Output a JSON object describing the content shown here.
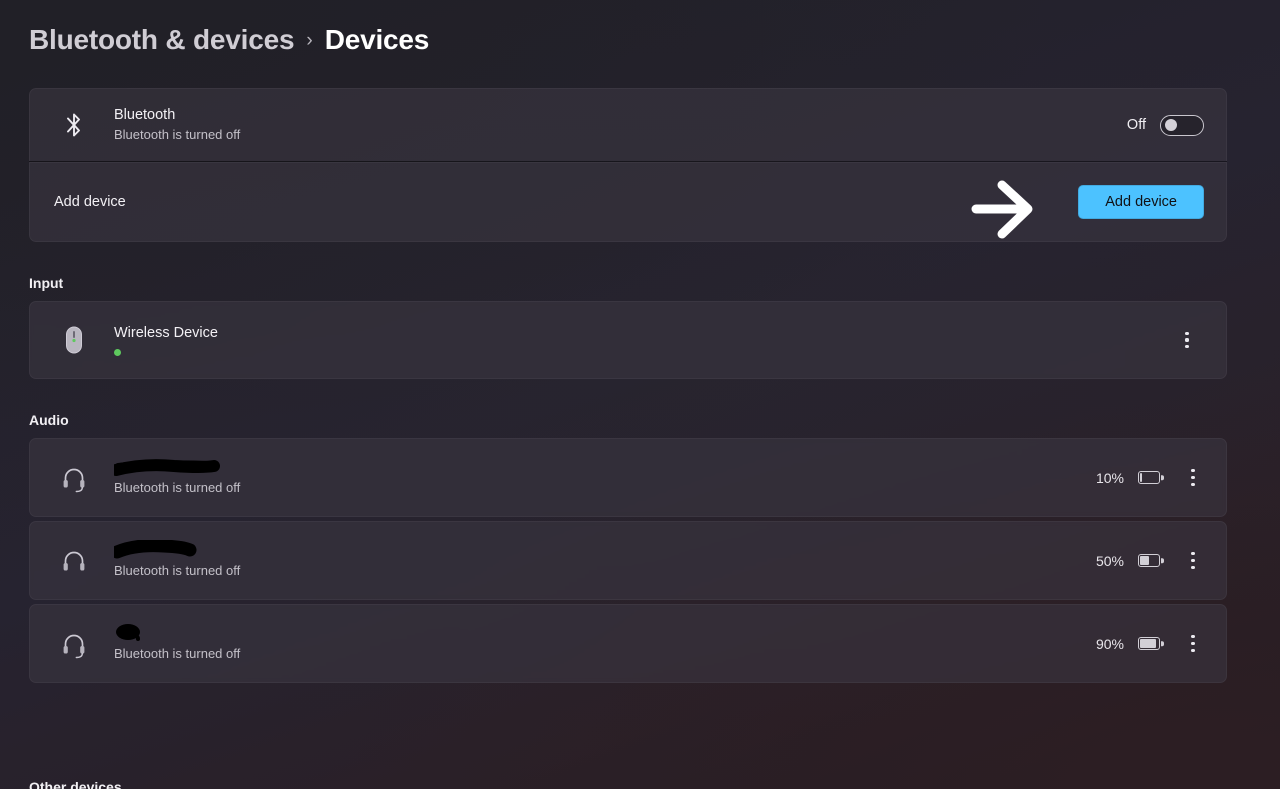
{
  "breadcrumb": {
    "parent": "Bluetooth & devices",
    "separator": "›",
    "current": "Devices"
  },
  "colors": {
    "accent": "#4cc2ff",
    "page_background": "#262330",
    "card_background": "#3a3640",
    "status_connected": "#5ec95e",
    "text_primary": "#ffffff",
    "text_secondary": "#c3c0c8"
  },
  "bluetooth_row": {
    "icon": "bluetooth-icon",
    "title": "Bluetooth",
    "subtitle": "Bluetooth is turned off",
    "toggle_label": "Off",
    "toggle_state": "off"
  },
  "add_device_row": {
    "label": "Add device",
    "button_label": "Add device"
  },
  "annotation": {
    "type": "arrow-right",
    "color": "#ffffff",
    "points_to": "add-device-button"
  },
  "sections": [
    {
      "id": "input",
      "heading": "Input",
      "devices": [
        {
          "icon": "mouse-icon",
          "name": "Wireless Device",
          "subtitle": "",
          "status": "connected",
          "redacted": false,
          "battery_percent": null,
          "menu": "more-options"
        }
      ]
    },
    {
      "id": "audio",
      "heading": "Audio",
      "devices": [
        {
          "icon": "headset-icon",
          "name": "",
          "subtitle": "Bluetooth is turned off",
          "status": "none",
          "redacted": true,
          "redaction_width": 100,
          "battery_percent": "10%",
          "battery_level": 10,
          "menu": "more-options"
        },
        {
          "icon": "headphones-icon",
          "name": "",
          "subtitle": "Bluetooth is turned off",
          "status": "none",
          "redacted": true,
          "redaction_width": 76,
          "battery_percent": "50%",
          "battery_level": 50,
          "menu": "more-options"
        },
        {
          "icon": "headset-icon",
          "name": "",
          "subtitle": "Bluetooth is turned off",
          "status": "none",
          "redacted": true,
          "redaction_width": 26,
          "battery_percent": "90%",
          "battery_level": 90,
          "menu": "more-options"
        }
      ]
    }
  ],
  "cutoff_section_heading": "Other devices"
}
